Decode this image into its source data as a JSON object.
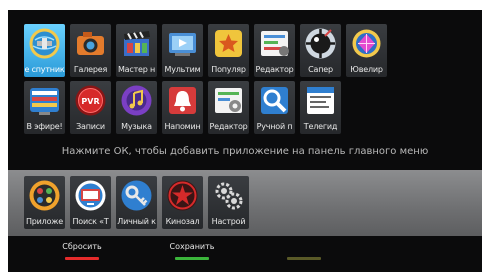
{
  "hint": "Нажмите ОК, чтобы добавить приложение на панель главного меню",
  "apps_row1": [
    {
      "label": "е спутник",
      "icon": "satellite-globe-icon",
      "selected": true
    },
    {
      "label": "Галерея",
      "icon": "camera-icon"
    },
    {
      "label": "Мастер н",
      "icon": "clapperboard-icon"
    },
    {
      "label": "Мультим",
      "icon": "multimedia-icon"
    },
    {
      "label": "Популяр",
      "icon": "star-icon"
    },
    {
      "label": "Редактор",
      "icon": "editor-icon"
    },
    {
      "label": "Сапер",
      "icon": "minesweeper-icon"
    },
    {
      "label": "Ювелир",
      "icon": "jeweler-icon"
    }
  ],
  "apps_row2": [
    {
      "label": "В эфире!",
      "icon": "on-air-icon"
    },
    {
      "label": "Записи",
      "icon": "pvr-icon"
    },
    {
      "label": "Музыка",
      "icon": "music-icon"
    },
    {
      "label": "Напомин",
      "icon": "reminder-icon"
    },
    {
      "label": "Редактор",
      "icon": "editor-gear-icon"
    },
    {
      "label": "Ручной п",
      "icon": "manual-search-icon"
    },
    {
      "label": "Телегид",
      "icon": "tv-guide-icon"
    }
  ],
  "panel_apps": [
    {
      "label": "Приложе",
      "icon": "applications-icon"
    },
    {
      "label": "Поиск «Т",
      "icon": "search-tv-icon"
    },
    {
      "label": "Личный к",
      "icon": "key-icon"
    },
    {
      "label": "Кинозал",
      "icon": "cinema-icon"
    },
    {
      "label": "Настрой",
      "icon": "settings-gears-icon"
    }
  ],
  "footer": {
    "reset_label": "Сбросить",
    "save_label": "Сохранить",
    "third_label": ""
  },
  "colors": {
    "reset": "#e52b2b",
    "save": "#3bb53b",
    "third": "#5a5a28",
    "selected_tile": "#3ab0ea"
  }
}
